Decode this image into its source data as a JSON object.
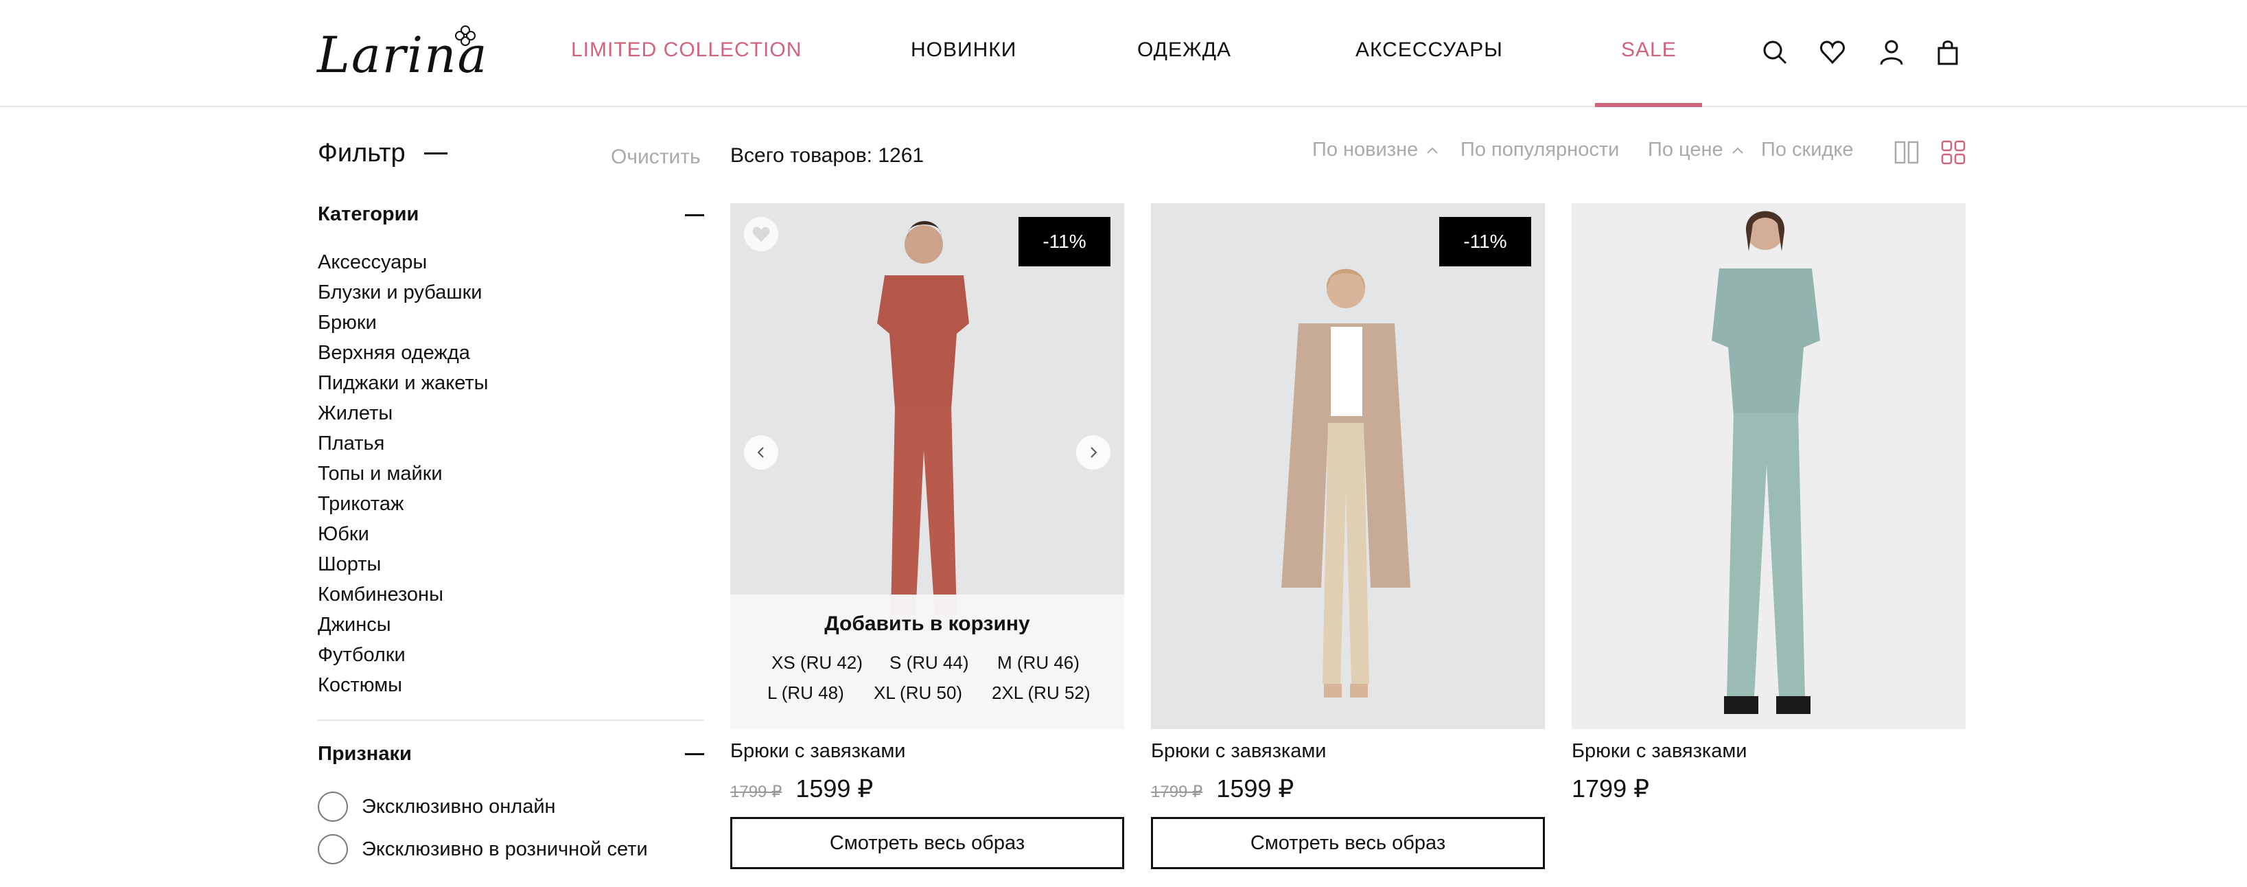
{
  "header": {
    "logo_text": "Larina",
    "nav": [
      {
        "label": "LIMITED COLLECTION",
        "accent": true
      },
      {
        "label": "НОВИНКИ",
        "accent": false
      },
      {
        "label": "ОДЕЖДА",
        "accent": false
      },
      {
        "label": "АКСЕССУАРЫ",
        "accent": false
      },
      {
        "label": "SALE",
        "accent": true
      }
    ],
    "icons": [
      "search-icon",
      "heart-icon",
      "user-icon",
      "bag-icon"
    ],
    "active_item": "SALE"
  },
  "filter": {
    "title": "Фильтр",
    "clear_label": "Очистить",
    "categories_title": "Категории",
    "categories": [
      "Аксессуары",
      "Блузки и рубашки",
      "Брюки",
      "Верхняя одежда",
      "Пиджаки и жакеты",
      "Жилеты",
      "Платья",
      "Топы и майки",
      "Трикотаж",
      "Юбки",
      "Шорты",
      "Комбинезоны",
      "Джинсы",
      "Футболки",
      "Костюмы"
    ],
    "features_title": "Признаки",
    "features": [
      "Эксклюзивно онлайн",
      "Эксклюзивно в розничной сети"
    ]
  },
  "toolbar": {
    "total": "Всего товаров: 1261",
    "sort": [
      "По новизне",
      "По популярности",
      "По цене",
      "По скидке"
    ]
  },
  "products": [
    {
      "name": "Брюки с завязками",
      "old_price": "1799 ₽",
      "price": "1599 ₽",
      "badge": "-11%",
      "look_button": "Смотреть весь образ",
      "add_to_cart": "Добавить в корзину",
      "sizes": [
        "XS (RU 42)",
        "S (RU 44)",
        "M (RU 46)",
        "L (RU 48)",
        "XL (RU 50)",
        "2XL (RU 52)"
      ]
    },
    {
      "name": "Брюки с завязками",
      "old_price": "1799 ₽",
      "price": "1599 ₽",
      "badge": "-11%",
      "look_button": "Смотреть весь образ"
    },
    {
      "name": "Брюки с завязками",
      "price": "1799 ₽"
    }
  ],
  "colors": {
    "accent": "#d0647c",
    "text": "#111111",
    "muted": "#aaaaaa",
    "image_bg": "#e3e5e7",
    "badge_bg": "#000000"
  }
}
